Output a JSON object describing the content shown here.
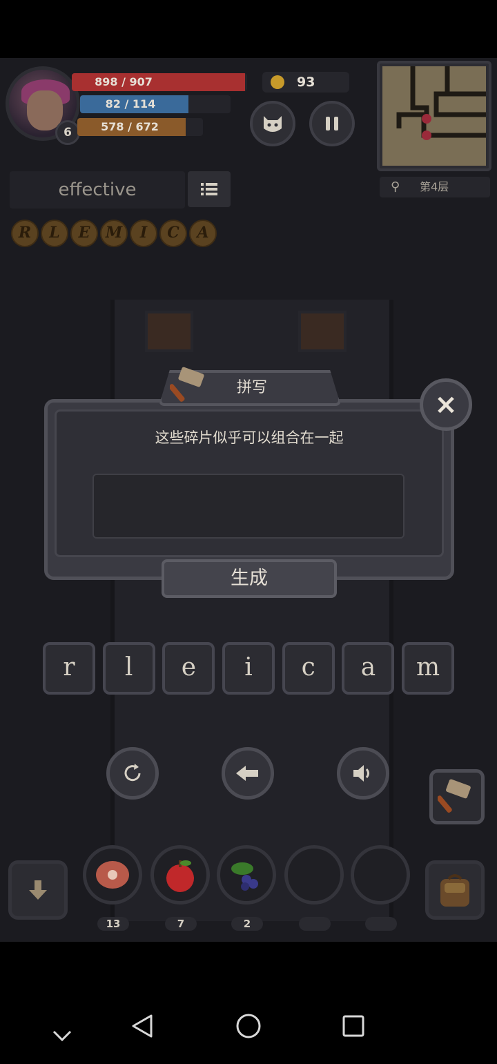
{
  "hud": {
    "player_level": "6",
    "hp": {
      "text": "898 / 907",
      "ratio": 0.99,
      "color": "#a83030"
    },
    "mp": {
      "text": "82 / 114",
      "ratio": 0.72,
      "color": "#3a6a9a"
    },
    "xp": {
      "text": "578 / 672",
      "ratio": 0.86,
      "color": "#8a5a2a"
    },
    "gold": "93"
  },
  "map": {
    "floor_label": "第4层"
  },
  "word": {
    "current": "effective",
    "fragments": [
      "R",
      "L",
      "E",
      "M",
      "I",
      "C",
      "A"
    ]
  },
  "dialog": {
    "title": "拼写",
    "message": "这些碎片似乎可以组合在一起",
    "input_value": "",
    "generate_label": "生成",
    "close_label": "×"
  },
  "letters": [
    "r",
    "l",
    "e",
    "i",
    "c",
    "a",
    "m"
  ],
  "inventory": {
    "items": [
      {
        "name": "meat",
        "count": "13"
      },
      {
        "name": "apple",
        "count": "7"
      },
      {
        "name": "berries",
        "count": "2"
      },
      {
        "name": "empty",
        "count": ""
      },
      {
        "name": "empty",
        "count": ""
      }
    ]
  },
  "colors": {
    "panel": "#3a3a42",
    "background": "#1b1b20",
    "accent": "#c79a2a"
  }
}
